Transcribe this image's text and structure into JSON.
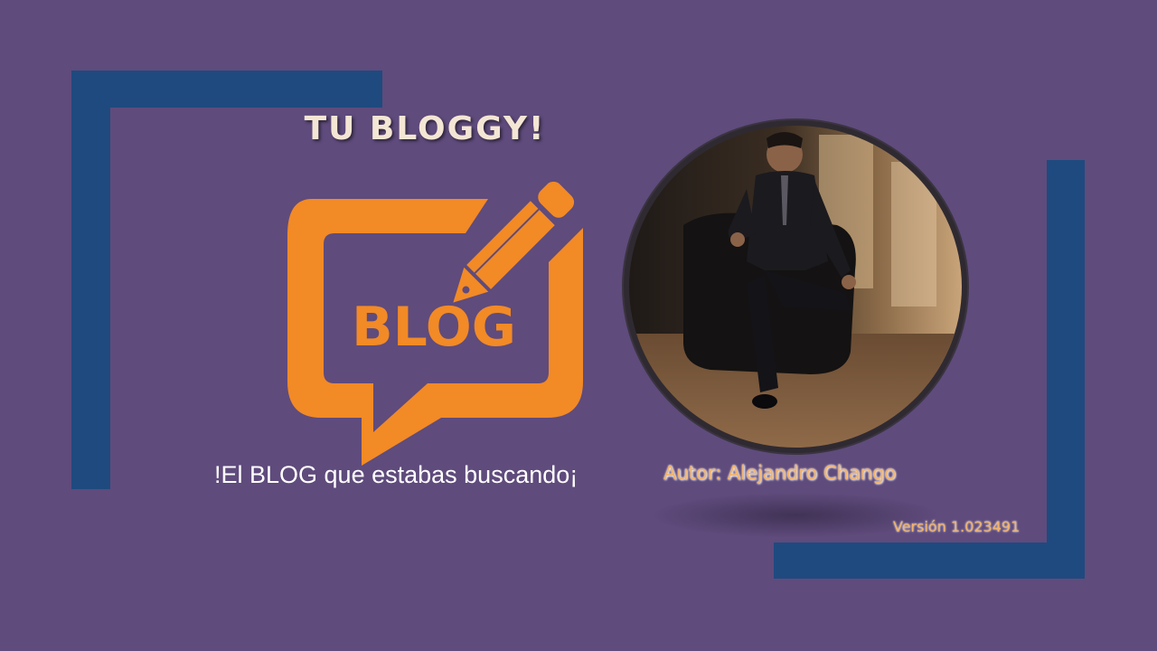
{
  "slide": {
    "title": "TU BLOGGY!",
    "logo_text": "BLOG",
    "tagline": "!El BLOG que estabas buscando¡",
    "author": "Autor: Alejandro Chango",
    "version": "Versión 1.023491"
  },
  "icons": {
    "logo": "blog-speech-bubble-pencil-icon",
    "photo": "author-photo"
  },
  "colors": {
    "background": "#5f4b7c",
    "frame": "#1f4a7f",
    "logo_orange": "#f28a26",
    "title": "#f4e6d4",
    "accent_text": "#f2b36a"
  }
}
